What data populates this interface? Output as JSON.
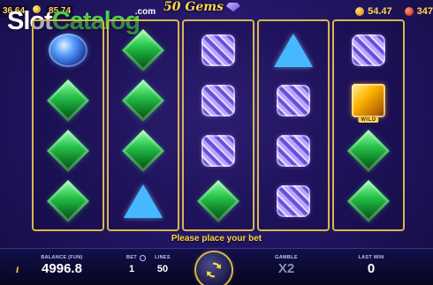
{
  "watermark": {
    "part1": "Slot",
    "part2": "Catalog",
    "suffix": ".com"
  },
  "top": {
    "jackpot_left_1": "36.64",
    "jackpot_left_2": "85.74",
    "logo": "50 Gems",
    "jackpot_right_1": "54.47",
    "jackpot_right_2": "347"
  },
  "reels": [
    [
      "blue-oval",
      "green",
      "green",
      "green"
    ],
    [
      "green",
      "green",
      "green",
      "blue-triangle"
    ],
    [
      "purple",
      "purple",
      "purple",
      "green"
    ],
    [
      "blue-triangle",
      "purple",
      "purple",
      "purple"
    ],
    [
      "purple",
      "wild",
      "green",
      "green"
    ]
  ],
  "wild_label": "WILD",
  "message": "Please place your bet",
  "bottom": {
    "info": "i",
    "balance_label": "BALANCE (FUN)",
    "balance_value": "4996.8",
    "bet_label": "BET",
    "bet_value": "1",
    "lines_label": "LINES",
    "lines_value": "50",
    "gamble_label": "GAMBLE",
    "gamble_value": "X2",
    "lastwin_label": "LAST WIN",
    "lastwin_value": "0"
  },
  "colors": {
    "accent": "#ffd64a",
    "reel_frame": "#d7b84a",
    "background": "#24176a"
  }
}
